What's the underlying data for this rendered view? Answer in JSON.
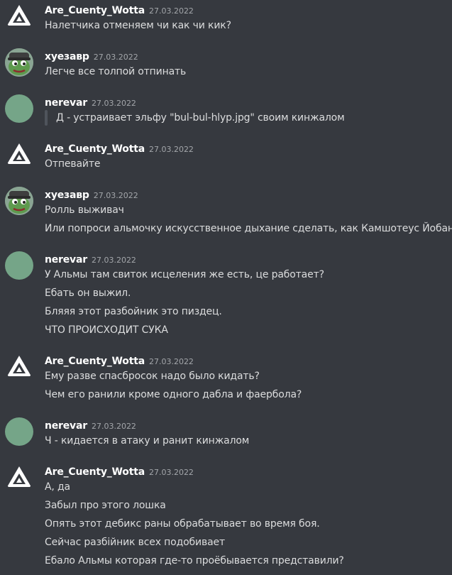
{
  "messages": [
    {
      "author": "Are_Cuenty_Wotta",
      "avatar": "triangle-logo-avatar",
      "timestamp": "27.03.2022",
      "lines": [
        "Налетчика отменяем чи как чи кик?"
      ]
    },
    {
      "author": "хуезавр",
      "avatar": "pepe-avatar",
      "timestamp": "27.03.2022",
      "lines": [
        "Легче все толпой отпинать"
      ]
    },
    {
      "author": "nerevar",
      "avatar": "green-circle-avatar",
      "timestamp": "27.03.2022",
      "quote": "Д - устраивает эльфу \"bul-bul-hlyp.jpg\" своим кинжалом"
    },
    {
      "author": "Are_Cuenty_Wotta",
      "avatar": "triangle-logo-avatar",
      "timestamp": "27.03.2022",
      "lines": [
        "Отпевайте"
      ]
    },
    {
      "author": "хуезавр",
      "avatar": "pepe-avatar",
      "timestamp": "27.03.2022",
      "lines": [
        "Ролль выживач",
        "Или попроси альмочку искусственное дыхание сделать, как Камшотеус Йобанусу"
      ]
    },
    {
      "author": "nerevar",
      "avatar": "green-circle-avatar",
      "timestamp": "27.03.2022",
      "lines": [
        "У Альмы там свиток исцеления же есть, це работает?",
        "Ебать он выжил.",
        "Бляяя этот разбойник это пиздец.",
        "ЧТО ПРОИСХОДИТ СУКА"
      ]
    },
    {
      "author": "Are_Cuenty_Wotta",
      "avatar": "triangle-logo-avatar",
      "timestamp": "27.03.2022",
      "lines": [
        "Ему разве спасбросок надо было кидать?",
        "Чем его ранили кроме одного дабла и фаербола?"
      ]
    },
    {
      "author": "nerevar",
      "avatar": "green-circle-avatar",
      "timestamp": "27.03.2022",
      "lines": [
        "Ч - кидается в атаку и ранит кинжалом"
      ]
    },
    {
      "author": "Are_Cuenty_Wotta",
      "avatar": "triangle-logo-avatar",
      "timestamp": "27.03.2022",
      "lines": [
        "А, да",
        "Забыл про этого лошка",
        "Опять этот дебикс раны обрабатывает во время боя.",
        "Сейчас разбійник всех подобивает",
        "Ебало Альмы которая где-то проёбывается представили?"
      ]
    }
  ],
  "colors": {
    "background": "#36393f",
    "username": "#ffffff",
    "timestamp": "#a3a6aa",
    "message_text": "#dcddde",
    "quote_bar": "#4f545c",
    "nerevar_avatar": "#75a588"
  }
}
